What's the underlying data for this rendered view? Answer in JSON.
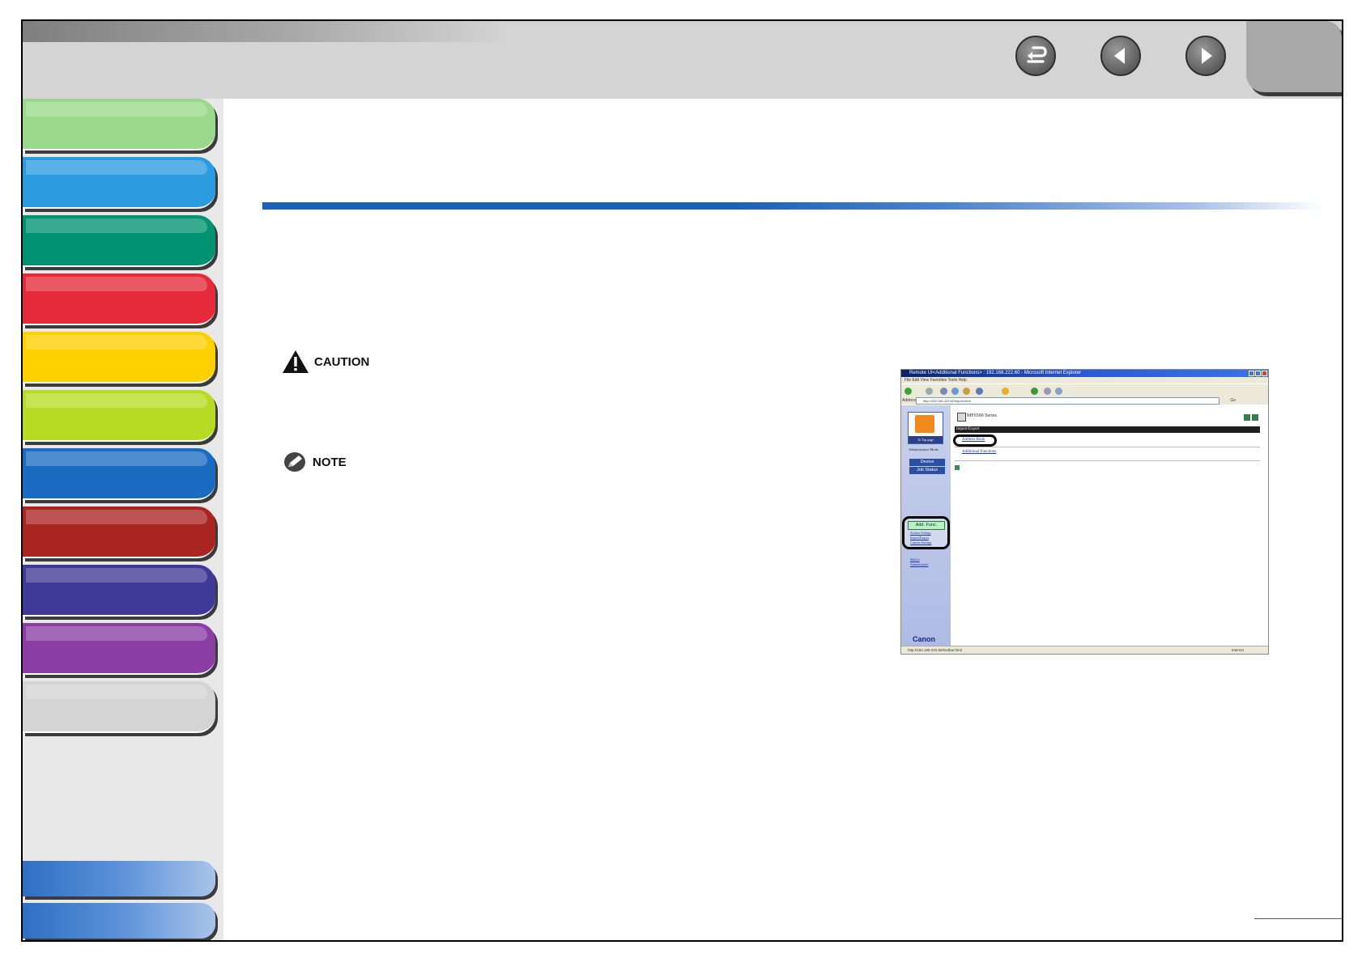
{
  "colors": {
    "header_bg": "#d4d4d4",
    "sidebar_bg": "#e8e8e8",
    "title_rule": "#1c62b7",
    "chapter_tabs": [
      "#9ad98c",
      "#2b9be0",
      "#009270",
      "#e52a3c",
      "#fdd000",
      "#b6db25",
      "#1a6cc2",
      "#a82522",
      "#3f3a97",
      "#8a3ea3",
      "#d4d4d4"
    ]
  },
  "nav": {
    "back_icon": "return-arrow-icon",
    "previous_icon": "triangle-left-icon",
    "next_icon": "triangle-right-icon"
  },
  "notices": {
    "caution_label": "CAUTION",
    "caution_icon": "warning-triangle-icon",
    "note_label": "NOTE",
    "note_icon": "pencil-icon"
  },
  "screenshot": {
    "window_title": "Remote UI<Additional Functions> : 192.168.222.60 - Microsoft Internet Explorer",
    "menu": "File   Edit   View   Favorites   Tools   Help",
    "address_label": "Address",
    "address_url": "http://192.168.222.60/import.html",
    "go_label": "Go",
    "logo_caption": "To Top page",
    "mode_label": "Administrator Mode",
    "device_button": "Device",
    "job_status_button": "Job Status",
    "add_func_button": "Add. Func.",
    "links": [
      "System Settings",
      "Import/Export",
      "Custom Settings"
    ],
    "mail_link": "Mail to Administrator",
    "brand": "Canon",
    "series": "MF6500 Series",
    "section_header": "Import/Export",
    "address_book_link": "Address Book",
    "additional_functions_link": "Additional Functions",
    "status_url": "http://192.168.222.60/toolbar.html",
    "status_zone": "Internet"
  }
}
